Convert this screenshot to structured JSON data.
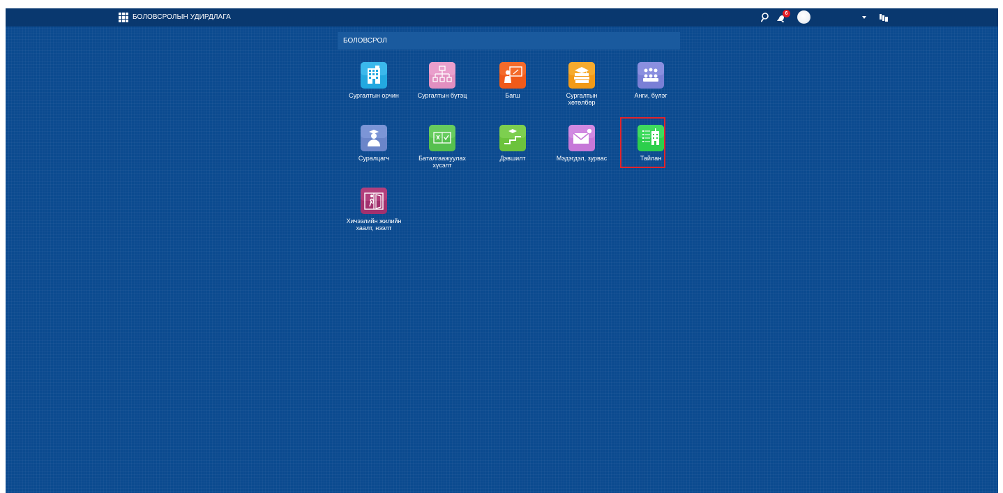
{
  "topbar": {
    "app_title": "БОЛОВСРОЛЫН УДИРДЛАГА",
    "notification_count": "6",
    "launcher_icon": "grid-icon",
    "search_icon": "search-icon",
    "bell_icon": "bell-icon",
    "avatar_icon": "avatar",
    "caret_icon": "chevron-down-icon",
    "apps_icon": "stacked-apps-icon"
  },
  "section": {
    "title": "БОЛОВСРОЛ"
  },
  "tiles": [
    {
      "label": "Сургалтын орчин",
      "icon": "building-icon",
      "color": "#23a8e0"
    },
    {
      "label": "Сургалтын бүтэц",
      "icon": "org-structure-icon",
      "color": "#e28fc0"
    },
    {
      "label": "Багш",
      "icon": "teacher-icon",
      "color": "#f05a1a"
    },
    {
      "label": "Сургалтын хөтөлбөр",
      "icon": "books-icon",
      "color": "#f29a17"
    },
    {
      "label": "Анги, бүлэг",
      "icon": "group-icon",
      "color": "#7a7fd6"
    },
    {
      "label": "Суралцагч",
      "icon": "student-icon",
      "color": "#6b85c9"
    },
    {
      "label": "Баталгаажуулах хүсэлт",
      "icon": "approval-icon",
      "color": "#56c04e"
    },
    {
      "label": "Дэвшилт",
      "icon": "promotion-icon",
      "color": "#6cc33c"
    },
    {
      "label": "Мэдэгдэл, зурвас",
      "icon": "mail-icon",
      "color": "#c678d8"
    },
    {
      "label": "Тайлан",
      "icon": "report-icon",
      "color": "#2ccf4c",
      "highlighted": true
    },
    {
      "label": "Хичээлийн жилийн хаалт, нээлт",
      "icon": "door-icon",
      "color": "#a2316e"
    }
  ],
  "colors": {
    "background": "#0b4a8f",
    "topbar": "#09386f",
    "section_header": "#1a5a9e",
    "highlight": "#e3242b",
    "badge": "#e41b23"
  }
}
